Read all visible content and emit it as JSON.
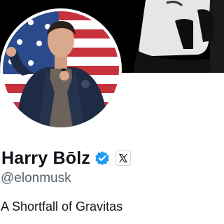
{
  "profile": {
    "display_name": "Harry Bōlz",
    "handle": "@elonmusk",
    "bio": "A Shortfall of Gravitas",
    "verified_badge_icon": "verified-checkmark-icon",
    "affiliate_badge_icon": "x-logo-icon",
    "avatar_icon": "profile-photo",
    "banner_icon": "header-photo"
  },
  "colors": {
    "name_text": "#0f1419",
    "handle_text": "#536471",
    "verified_blue": "#1d9bf0",
    "banner_bg": "#000000"
  }
}
